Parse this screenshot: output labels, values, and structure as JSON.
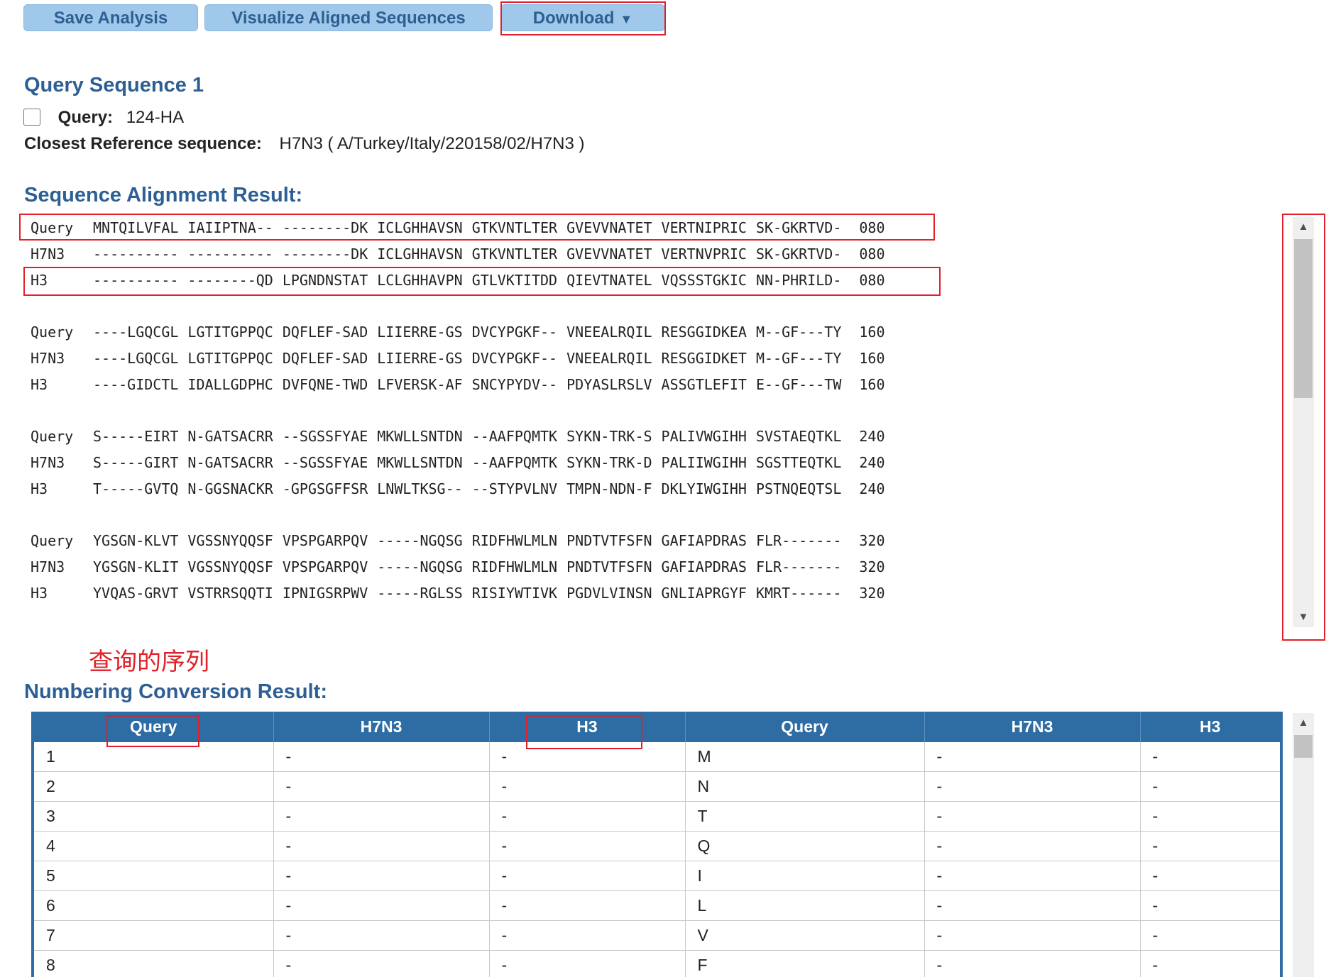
{
  "toolbar": {
    "save_label": "Save Analysis",
    "visualize_label": "Visualize Aligned Sequences",
    "download_label": "Download",
    "download_caret": "▼"
  },
  "query_section": {
    "title": "Query Sequence 1",
    "query_label": "Query:",
    "query_value": "124-HA",
    "closest_label": "Closest Reference sequence:",
    "closest_value": "H7N3 ( A/Turkey/Italy/220158/02/H7N3 )"
  },
  "alignment": {
    "title": "Sequence Alignment Result:",
    "blocks": [
      {
        "rows": [
          {
            "name": "Query",
            "segments": [
              "MNTQILVFAL",
              "IAIIPTNA--",
              "--------DK",
              "ICLGHHAVSN",
              "GTKVNTLTER",
              "GVEVVNATET",
              "VERTNIPRIC",
              "SK-GKRTVD-"
            ],
            "end": "080"
          },
          {
            "name": "H7N3",
            "segments": [
              "----------",
              "----------",
              "--------DK",
              "ICLGHHAVSN",
              "GTKVNTLTER",
              "GVEVVNATET",
              "VERTNVPRIC",
              "SK-GKRTVD-"
            ],
            "end": "080"
          },
          {
            "name": "H3",
            "segments": [
              "----------",
              "--------QD",
              "LPGNDNSTAT",
              "LCLGHHAVPN",
              "GTLVKTITDD",
              "QIEVTNATEL",
              "VQSSSTGKIC",
              "NN-PHRILD-"
            ],
            "end": "080"
          }
        ]
      },
      {
        "rows": [
          {
            "name": "Query",
            "segments": [
              "----LGQCGL",
              "LGTITGPPQC",
              "DQFLEF-SAD",
              "LIIERRE-GS",
              "DVCYPGKF--",
              "VNEEALRQIL",
              "RESGGIDKEA",
              "M--GF---TY"
            ],
            "end": "160"
          },
          {
            "name": "H7N3",
            "segments": [
              "----LGQCGL",
              "LGTITGPPQC",
              "DQFLEF-SAD",
              "LIIERRE-GS",
              "DVCYPGKF--",
              "VNEEALRQIL",
              "RESGGIDKET",
              "M--GF---TY"
            ],
            "end": "160"
          },
          {
            "name": "H3",
            "segments": [
              "----GIDCTL",
              "IDALLGDPHC",
              "DVFQNE-TWD",
              "LFVERSK-AF",
              "SNCYPYDV--",
              "PDYASLRSLV",
              "ASSGTLEFIT",
              "E--GF---TW"
            ],
            "end": "160"
          }
        ]
      },
      {
        "rows": [
          {
            "name": "Query",
            "segments": [
              "S-----EIRT",
              "N-GATSACRR",
              "--SGSSFYAE",
              "MKWLLSNTDN",
              "--AAFPQMTK",
              "SYKN-TRK-S",
              "PALIVWGIHH",
              "SVSTAEQTKL"
            ],
            "end": "240"
          },
          {
            "name": "H7N3",
            "segments": [
              "S-----GIRT",
              "N-GATSACRR",
              "--SGSSFYAE",
              "MKWLLSNTDN",
              "--AAFPQMTK",
              "SYKN-TRK-D",
              "PALIIWGIHH",
              "SGSTTEQTKL"
            ],
            "end": "240"
          },
          {
            "name": "H3",
            "segments": [
              "T-----GVTQ",
              "N-GGSNACKR",
              "-GPGSGFFSR",
              "LNWLTKSG--",
              "--STYPVLNV",
              "TMPN-NDN-F",
              "DKLYIWGIHH",
              "PSTNQEQTSL"
            ],
            "end": "240"
          }
        ]
      },
      {
        "rows": [
          {
            "name": "Query",
            "segments": [
              "YGSGN-KLVT",
              "VGSSNYQQSF",
              "VPSPGARPQV",
              "-----NGQSG",
              "RIDFHWLMLN",
              "PNDTVTFSFN",
              "GAFIAPDRAS",
              "FLR-------"
            ],
            "end": "320"
          },
          {
            "name": "H7N3",
            "segments": [
              "YGSGN-KLIT",
              "VGSSNYQQSF",
              "VPSPGARPQV",
              "-----NGQSG",
              "RIDFHWLMLN",
              "PNDTVTFSFN",
              "GAFIAPDRAS",
              "FLR-------"
            ],
            "end": "320"
          },
          {
            "name": "H3",
            "segments": [
              "YVQAS-GRVT",
              "VSTRRSQQTI",
              "IPNIGSRPWV",
              "-----RGLSS",
              "RISIYWTIVK",
              "PGDVLVINSN",
              "GNLIAPRGYF",
              "KMRT------"
            ],
            "end": "320"
          }
        ]
      }
    ]
  },
  "annotation": {
    "text": "查询的序列",
    "color": "#e0202a"
  },
  "numbering": {
    "title": "Numbering Conversion Result:",
    "headers": [
      "Query",
      "H7N3",
      "H3",
      "Query",
      "H7N3",
      "H3"
    ],
    "rows": [
      [
        "1",
        "-",
        "-",
        "M",
        "-",
        "-"
      ],
      [
        "2",
        "-",
        "-",
        "N",
        "-",
        "-"
      ],
      [
        "3",
        "-",
        "-",
        "T",
        "-",
        "-"
      ],
      [
        "4",
        "-",
        "-",
        "Q",
        "-",
        "-"
      ],
      [
        "5",
        "-",
        "-",
        "I",
        "-",
        "-"
      ],
      [
        "6",
        "-",
        "-",
        "L",
        "-",
        "-"
      ],
      [
        "7",
        "-",
        "-",
        "V",
        "-",
        "-"
      ],
      [
        "8",
        "-",
        "-",
        "F",
        "-",
        "-"
      ]
    ]
  },
  "colors": {
    "heading": "#2e5f94",
    "button_bg": "#9fc8ea",
    "table_header_bg": "#2e6ca4",
    "highlight_red": "#e0202a"
  }
}
